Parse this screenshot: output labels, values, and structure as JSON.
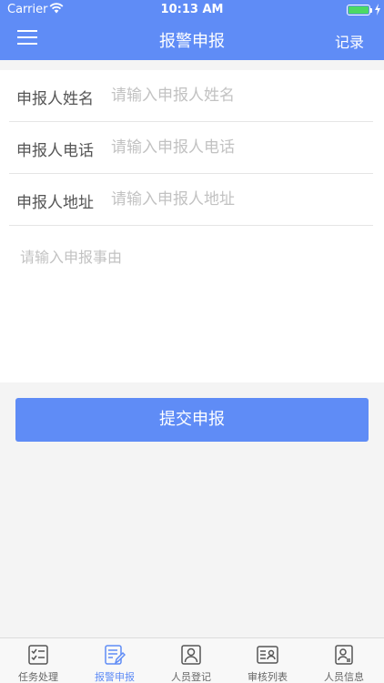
{
  "status_bar": {
    "carrier": "Carrier",
    "time": "10:13 AM"
  },
  "nav": {
    "title": "报警申报",
    "right_action": "记录"
  },
  "form": {
    "name_label": "申报人姓名",
    "name_placeholder": "请输入申报人姓名",
    "phone_label": "申报人电话",
    "phone_placeholder": "请输入申报人电话",
    "address_label": "申报人地址",
    "address_placeholder": "请输入申报人地址",
    "reason_placeholder": "请输入申报事由"
  },
  "submit_label": "提交申报",
  "tab_bar": {
    "tabs": [
      {
        "label": "任务处理",
        "icon": "task-checklist-icon"
      },
      {
        "label": "报警申报",
        "icon": "report-edit-icon",
        "active": true
      },
      {
        "label": "人员登记",
        "icon": "person-register-icon"
      },
      {
        "label": "审核列表",
        "icon": "review-list-icon"
      },
      {
        "label": "人员信息",
        "icon": "person-info-icon"
      }
    ]
  },
  "colors": {
    "primary": "#5f8cf6",
    "background": "#f4f4f4",
    "placeholder": "#c2c2c2",
    "label": "#555555",
    "battery": "#4cd964"
  }
}
